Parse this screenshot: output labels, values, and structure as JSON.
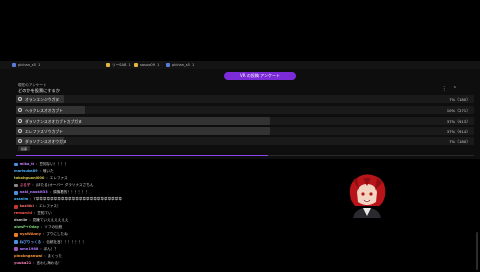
{
  "predictions_bar": {
    "items": [
      {
        "name": "pichan_s5",
        "count": "1",
        "icon_color": "#5b7bd8"
      },
      {
        "name": "リーSAB",
        "count": "1",
        "icon_color": "#e0b640"
      },
      {
        "name": "sasuo09",
        "count": "1",
        "icon_color": "#e0b640"
      },
      {
        "name": "pichan_s5",
        "count": "1",
        "icon_color": "#5b7bd8"
      }
    ]
  },
  "poll": {
    "header_label": "VR の投稿 アンケート",
    "meta": "現在のアンケート",
    "question": "どのかを投票にするか",
    "vote_label": "投票",
    "options": [
      {
        "label": "オランエンジウガヌ",
        "percent": "7%（180）",
        "share": 0.07
      },
      {
        "label": "ヘラクレスオオカブト",
        "percent": "10%（271）",
        "share": 0.1
      },
      {
        "label": "ダラソナンスオオカブトカブガヌ",
        "percent": "37%（913）",
        "share": 0.37
      },
      {
        "label": "エレファスゾウカブト",
        "percent": "37%（914）",
        "share": 0.37
      },
      {
        "label": "ダラソナンスオオウガヌ",
        "percent": "7%（180）",
        "share": 0.07
      }
    ],
    "timer_progress": 0.55
  },
  "chat": [
    {
      "badge": "#4a90e2",
      "name": "mika_ti",
      "name_color": "#c77dff",
      "msg": "豆知ない！！！！"
    },
    {
      "badge": "",
      "name": "marisuke89",
      "name_color": "#4fb0ff",
      "msg": "喰いた"
    },
    {
      "badge": "",
      "name": "takahguoni000",
      "name_color": "#d3c84b",
      "msg": "エレファス"
    },
    {
      "badge": "#888888",
      "name": "ぶる子",
      "name_color": "#e05a8a",
      "msg": "(ほたる)オーバー ダラソナスさちん"
    },
    {
      "badge": "#4a90e2",
      "name": "naki_naokit33",
      "name_color": "#b47cff",
      "msg": "調機着的！！！！！！"
    },
    {
      "badge": "",
      "name": "ossnim",
      "name_color": "#4ab8ff",
      "msg": "T草草草草草草草草草草草草草草草草草草草草草草草草"
    },
    {
      "badge": "#c0392b",
      "name": "kozi4ki",
      "name_color": "#ff6b6b",
      "msg": "エレファス！"
    },
    {
      "badge": "",
      "name": "remarchi",
      "name_color": "#ff5b5b",
      "msg": "豆知てい"
    },
    {
      "badge": "",
      "name": "dsmile",
      "name_color": "#c6c6c6",
      "msg": "見嫌ていええええええ"
    },
    {
      "badge": "",
      "name": "alwsP+Oday",
      "name_color": "#7cd87c",
      "msg": "ソフの伝統"
    },
    {
      "badge": "#e67e22",
      "name": "nyaWAnny",
      "name_color": "#ff8c42",
      "msg": "ブウにしたね"
    },
    {
      "badge": "#4a90e2",
      "name": "ねびりっくる",
      "name_color": "#6fa8ff",
      "msg": "伝統壮言！！！！！！！"
    },
    {
      "badge": "#9b59b6",
      "name": "amn1988",
      "name_color": "#b07cff",
      "msg": "ほん！？"
    },
    {
      "badge": "",
      "name": "pinoknganwai",
      "name_color": "#ff9a3c",
      "msg": "まくった"
    },
    {
      "badge": "",
      "name": "yuuka21",
      "name_color": "#ff7fbf",
      "msg": "言わし海わる！"
    }
  ],
  "colors": {
    "accent": "#7b2bd8",
    "timer": "#8a45f0"
  },
  "icons": {
    "avatar": "red-haired-anime-avatar"
  }
}
